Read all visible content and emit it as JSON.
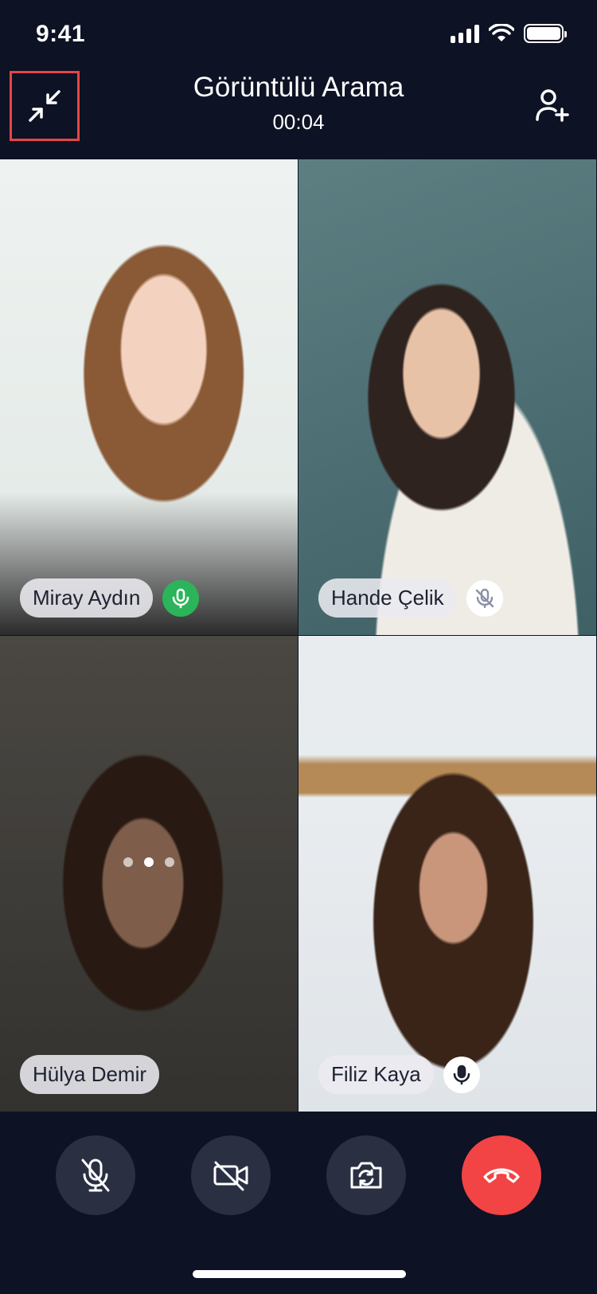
{
  "status_bar": {
    "time": "9:41"
  },
  "header": {
    "title": "Görüntülü Arama",
    "timer": "00:04"
  },
  "participants": [
    {
      "name": "Miray Aydın",
      "mic": "active"
    },
    {
      "name": "Hande Çelik",
      "mic": "muted"
    },
    {
      "name": "Hülya Demir",
      "mic": "none",
      "state": "connecting"
    },
    {
      "name": "Filiz Kaya",
      "mic": "on"
    }
  ],
  "controls": [
    "mute-mic",
    "camera-off",
    "flip-camera",
    "end-call"
  ],
  "colors": {
    "background": "#0d1224",
    "end_call": "#f24444",
    "active_mic": "#2bb45a",
    "highlight_border": "#e64545"
  }
}
